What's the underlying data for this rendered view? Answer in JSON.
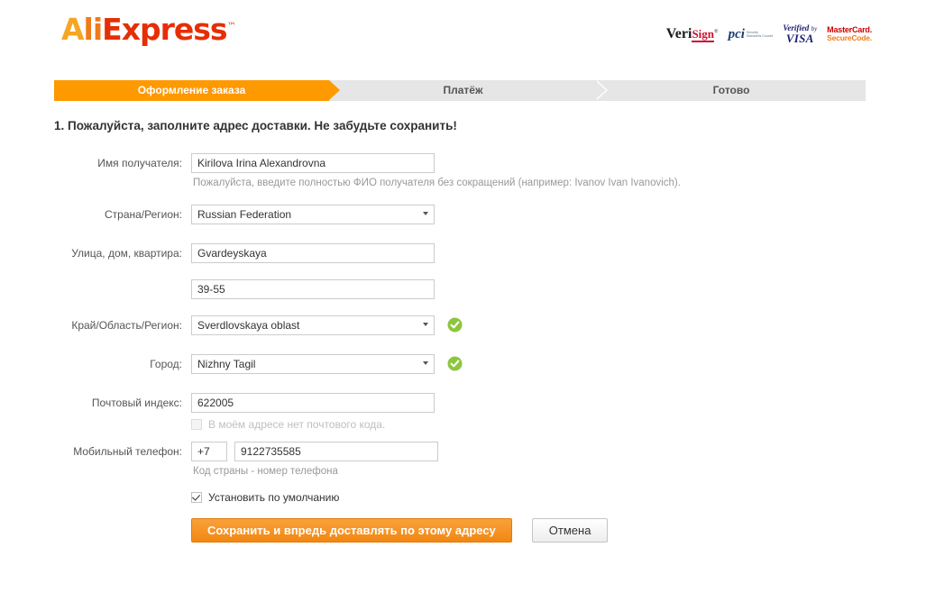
{
  "brand": {
    "name_a": "A",
    "name_li": "li",
    "name_rest": "Express",
    "trademark": "™"
  },
  "badges": {
    "verisign_veri": "Veri",
    "verisign_sign": "Sign",
    "verisign_tm": "®",
    "pci_mark": "pci",
    "pci_line1": "Security",
    "pci_line2": "Standards Council",
    "visa_verified": "Verified",
    "visa_by": "by",
    "visa_brand": "VISA",
    "mc_line1": "MasterCard.",
    "mc_line2": "SecureCode."
  },
  "steps": [
    {
      "label": "Оформление заказа",
      "active": true
    },
    {
      "label": "Платёж",
      "active": false
    },
    {
      "label": "Готово",
      "active": false
    }
  ],
  "form": {
    "heading": "1. Пожалуйста, заполните адрес доставки. Не забудьте сохранить!",
    "recipient": {
      "label": "Имя получателя:",
      "value": "Kirilova Irina Alexandrovna",
      "hint": "Пожалуйста, введите полностью ФИО получателя без сокращений (например: Ivanov Ivan Ivanovich)."
    },
    "country": {
      "label": "Страна/Регион:",
      "value": "Russian Federation"
    },
    "street": {
      "label": "Улица, дом, квартира:",
      "value": "Gvardeyskaya",
      "value2": "39-55"
    },
    "region": {
      "label": "Край/Область/Регион:",
      "value": "Sverdlovskaya oblast",
      "valid": true
    },
    "city": {
      "label": "Город:",
      "value": "Nizhny Tagil",
      "valid": true
    },
    "zip": {
      "label": "Почтовый индекс:",
      "value": "622005",
      "no_zip_label": "В моём адресе нет почтового кода."
    },
    "phone": {
      "label": "Мобильный телефон:",
      "country_code": "+7",
      "number": "9122735585",
      "hint": "Код страны - номер телефона"
    },
    "default_address_label": "Установить по умолчанию",
    "save_button": "Сохранить и впредь доставлять по этому адресу",
    "cancel_button": "Отмена"
  },
  "colors": {
    "accent_orange": "#ff9900",
    "button_orange": "#f18713",
    "valid_green": "#8cc63f",
    "step_inactive": "#e6e6e6"
  }
}
